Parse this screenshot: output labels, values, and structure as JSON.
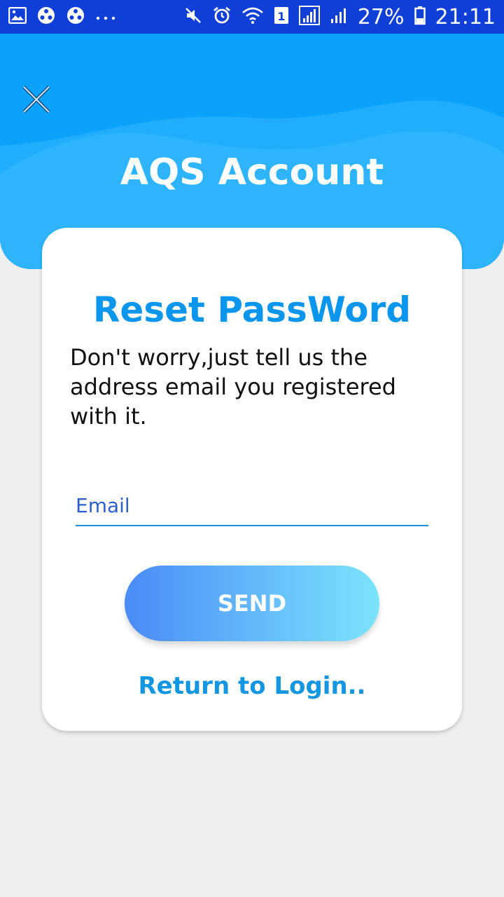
{
  "status_bar": {
    "battery_percent": "27%",
    "time": "21:11",
    "left_icons": [
      "gallery-icon",
      "app-hex-icon",
      "app-hex-icon",
      "more-dots-icon"
    ],
    "right_icons": [
      "mute-icon",
      "alarm-icon",
      "wifi-icon",
      "sim-icon",
      "signal-icon",
      "signal-icon",
      "battery-icon"
    ],
    "sim_number": "1"
  },
  "header": {
    "title": "AQS Account",
    "close_icon": "close-icon"
  },
  "card": {
    "title": "Reset PassWord",
    "description": "Don't worry,just tell us the address email you registered with it.",
    "email_placeholder": "Email",
    "send_label": "SEND",
    "return_label": "Return to Login.."
  },
  "colors": {
    "status_bar": "#0f3fd6",
    "header": "#0aa2fb",
    "accent": "#0b96ee",
    "button_gradient_start": "#4a8bf7",
    "button_gradient_end": "#7ce4fb"
  }
}
